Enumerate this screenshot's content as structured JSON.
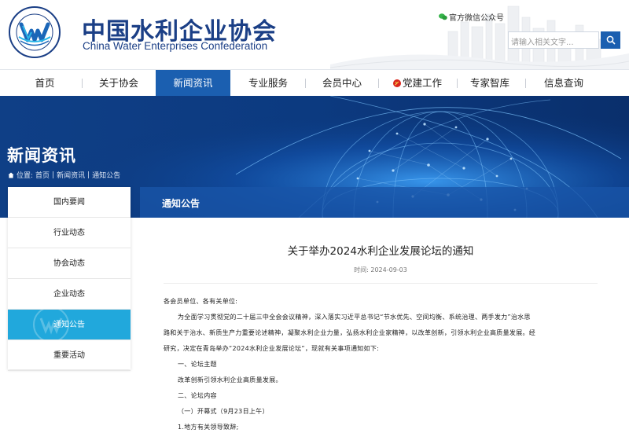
{
  "brand": {
    "name_cn": "中国水利企业协会",
    "name_en": "China Water Enterprises Confederation",
    "logo_ring_text": "中国水利企业协会"
  },
  "header": {
    "wechat_label": "官方微信公众号",
    "search_placeholder": "请输入相关文字..."
  },
  "nav": {
    "items": [
      {
        "label": "首页"
      },
      {
        "label": "关于协会"
      },
      {
        "label": "新闻资讯",
        "active": true
      },
      {
        "label": "专业服务"
      },
      {
        "label": "会员中心"
      },
      {
        "label": "党建工作",
        "icon": "party-emblem-icon"
      },
      {
        "label": "专家智库"
      },
      {
        "label": "信息查询"
      }
    ]
  },
  "banner": {
    "title": "新闻资讯",
    "breadcrumb": {
      "prefix": "位置:",
      "items": [
        "首页",
        "新闻资讯",
        "通知公告"
      ]
    }
  },
  "sidebar": {
    "items": [
      {
        "label": "国内要闻"
      },
      {
        "label": "行业动态"
      },
      {
        "label": "协会动态"
      },
      {
        "label": "企业动态"
      },
      {
        "label": "通知公告",
        "active": true
      },
      {
        "label": "重要活动"
      }
    ]
  },
  "panel": {
    "title": "通知公告"
  },
  "article": {
    "title": "关于举办2024水利企业发展论坛的通知",
    "date": "时间: 2024-09-03",
    "paragraphs": [
      "各会员单位、各有关单位:",
      "为全面学习贯彻党的二十届三中全会会议精神，深入落实习近平总书记“节水优先、空间均衡、系统治理、两手发力”治水思",
      "路和关于治水、新质生产力重要论述精神，凝聚水利企业力量，弘扬水利企业家精神，以改革创新，引领水利企业高质量发展。经",
      "研究，决定在青岛举办“2024水利企业发展论坛”，现就有关事项通知如下:",
      "一、论坛主题",
      "改革创新引领水利企业高质量发展。",
      "二、论坛内容",
      "（一）开幕式（9月23日上午）",
      "1.地方有关领导致辞;"
    ]
  },
  "colors": {
    "brand_blue": "#1b3f86",
    "nav_active": "#1b5fb0",
    "sidebar_active": "#21a8dc",
    "banner_bg": "#0a3576"
  }
}
